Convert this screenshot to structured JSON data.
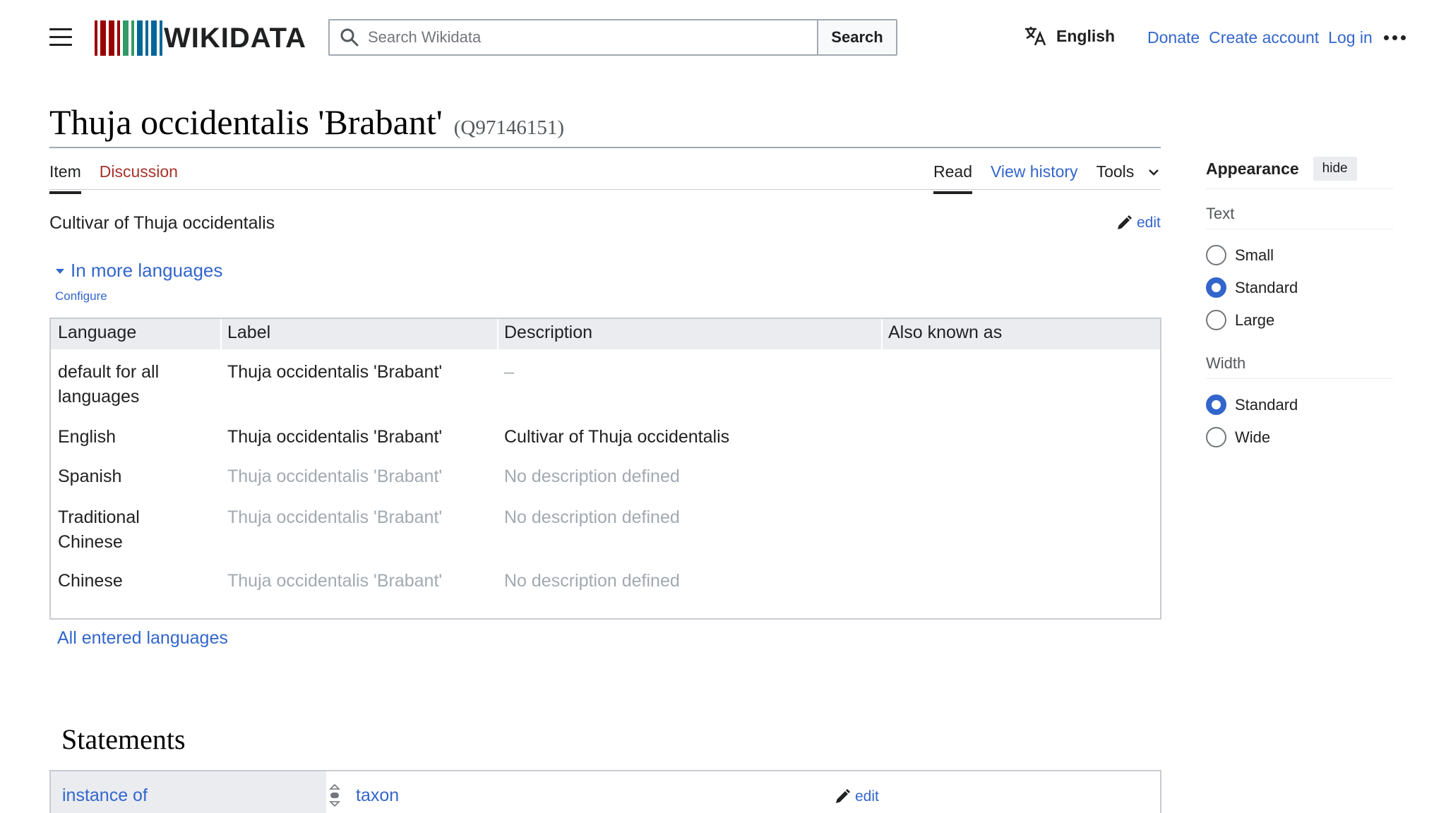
{
  "header": {
    "logo_text": "WIKIDATA",
    "logo_colors": [
      "#990000",
      "#339966",
      "#006699"
    ],
    "search_placeholder": "Search Wikidata",
    "search_button": "Search",
    "language": "English",
    "links": [
      "Donate",
      "Create account",
      "Log in"
    ]
  },
  "page": {
    "title": "Thuja occidentalis 'Brabant'",
    "qid": "(Q97146151)",
    "tabs_left": [
      {
        "label": "Item",
        "selected": true
      },
      {
        "label": "Discussion",
        "selected": false
      }
    ],
    "tabs_right": [
      {
        "label": "Read",
        "selected": true
      },
      {
        "label": "View history",
        "selected": false
      },
      {
        "label": "Tools",
        "selected": false
      }
    ],
    "description": "Cultivar of Thuja occidentalis",
    "edit_label": "edit",
    "more_languages": "In more languages",
    "configure": "Configure",
    "all_languages": "All entered languages"
  },
  "lang_table": {
    "headers": [
      "Language",
      "Label",
      "Description",
      "Also known as"
    ],
    "rows": [
      {
        "language": [
          "default for all",
          "languages"
        ],
        "label": "Thuja occidentalis 'Brabant'",
        "description": "–",
        "label_muted": false,
        "desc_muted": true
      },
      {
        "language": [
          "English"
        ],
        "label": "Thuja occidentalis 'Brabant'",
        "description": "Cultivar of Thuja occidentalis",
        "label_muted": false,
        "desc_muted": false
      },
      {
        "language": [
          "Spanish"
        ],
        "label": "Thuja occidentalis 'Brabant'",
        "description": "No description defined",
        "label_muted": true,
        "desc_muted": true
      },
      {
        "language": [
          "Traditional",
          "Chinese"
        ],
        "label": "Thuja occidentalis 'Brabant'",
        "description": "No description defined",
        "label_muted": true,
        "desc_muted": true
      },
      {
        "language": [
          "Chinese"
        ],
        "label": "Thuja occidentalis 'Brabant'",
        "description": "No description defined",
        "label_muted": true,
        "desc_muted": true
      }
    ]
  },
  "statements": {
    "heading": "Statements",
    "items": [
      {
        "property": "instance of",
        "value": "taxon",
        "edit": "edit"
      }
    ]
  },
  "appearance": {
    "title": "Appearance",
    "hide": "hide",
    "text_label": "Text",
    "text_options": [
      {
        "label": "Small",
        "checked": false
      },
      {
        "label": "Standard",
        "checked": true
      },
      {
        "label": "Large",
        "checked": false
      }
    ],
    "width_label": "Width",
    "width_options": [
      {
        "label": "Standard",
        "checked": true
      },
      {
        "label": "Wide",
        "checked": false
      }
    ]
  }
}
